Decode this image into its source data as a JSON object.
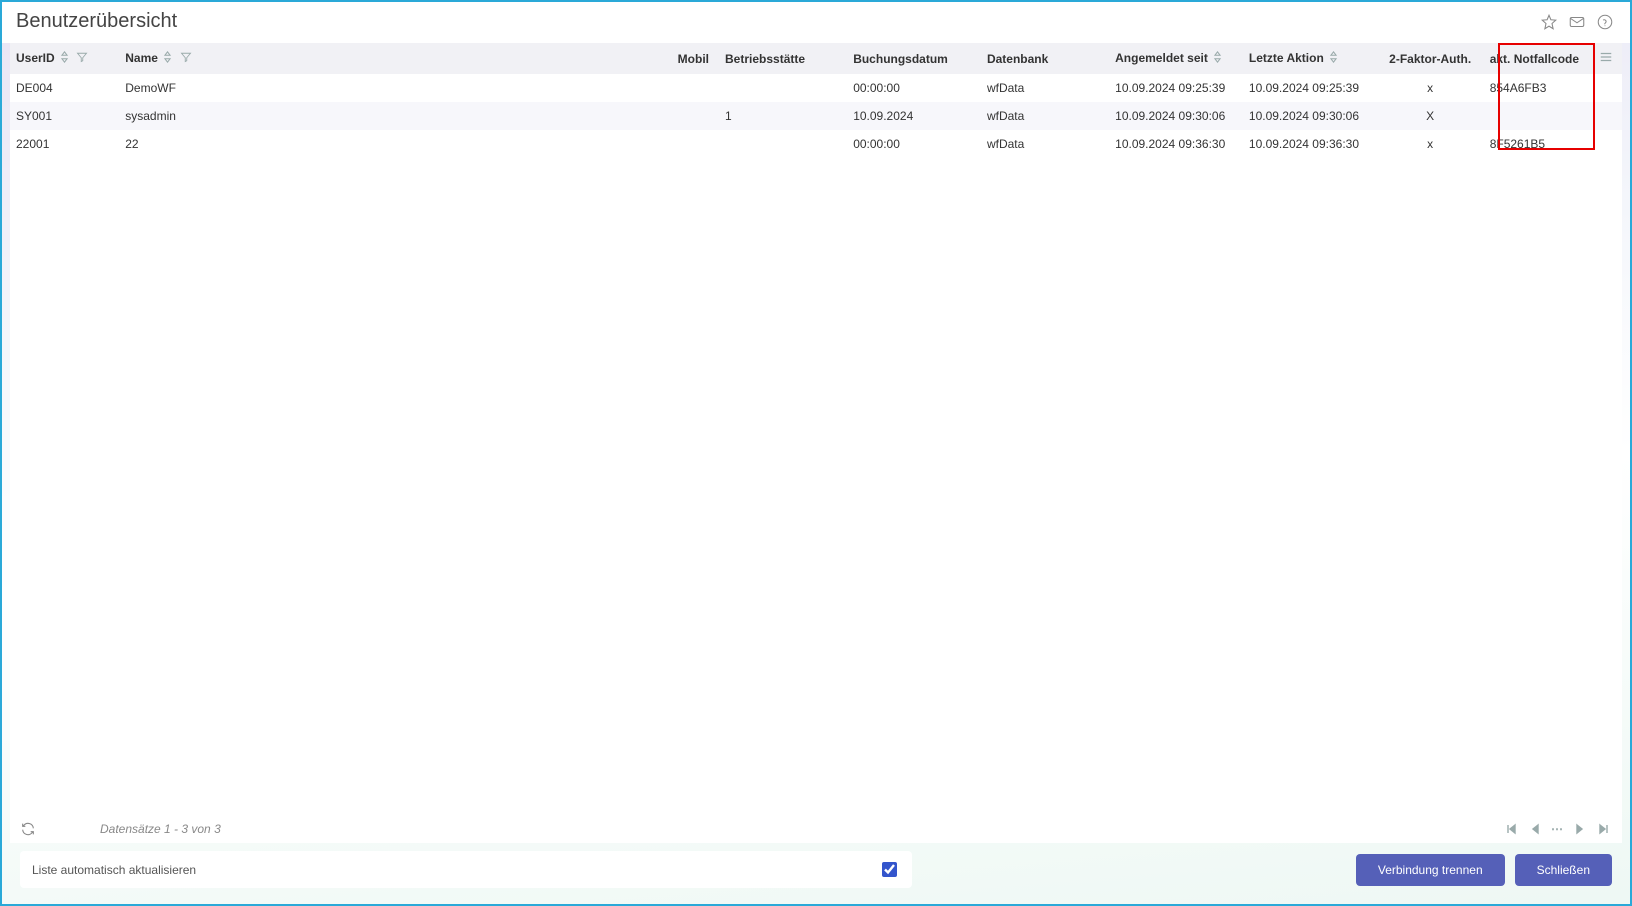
{
  "header": {
    "title": "Benutzerübersicht"
  },
  "columns": {
    "userid": "UserID",
    "name": "Name",
    "mobil": "Mobil",
    "betrieb": "Betriebsstätte",
    "buch": "Buchungsdatum",
    "db": "Datenbank",
    "angem": "Angemeldet seit",
    "aktion": "Letzte Aktion",
    "twofa": "2-Faktor-Auth.",
    "notf": "akt. Notfallcode"
  },
  "rows": [
    {
      "userid": "DE004",
      "name": "DemoWF",
      "mobil": "",
      "betrieb": "",
      "buch": "00:00:00",
      "db": "wfData",
      "angem": "10.09.2024 09:25:39",
      "aktion": "10.09.2024 09:25:39",
      "twofa": "x",
      "notf": "854A6FB3"
    },
    {
      "userid": "SY001",
      "name": "sysadmin",
      "mobil": "",
      "betrieb": "1",
      "buch": "10.09.2024",
      "db": "wfData",
      "angem": "10.09.2024 09:30:06",
      "aktion": "10.09.2024 09:30:06",
      "twofa": "X",
      "notf": ""
    },
    {
      "userid": "22001",
      "name": "22",
      "mobil": "",
      "betrieb": "",
      "buch": "00:00:00",
      "db": "wfData",
      "angem": "10.09.2024 09:36:30",
      "aktion": "10.09.2024 09:36:30",
      "twofa": "x",
      "notf": "8F5261B5"
    }
  ],
  "status": {
    "records": "Datensätze 1 - 3 von 3"
  },
  "footer": {
    "auto_update_label": "Liste automatisch aktualisieren",
    "auto_update_checked": true,
    "disconnect": "Verbindung trennen",
    "close": "Schließen"
  }
}
